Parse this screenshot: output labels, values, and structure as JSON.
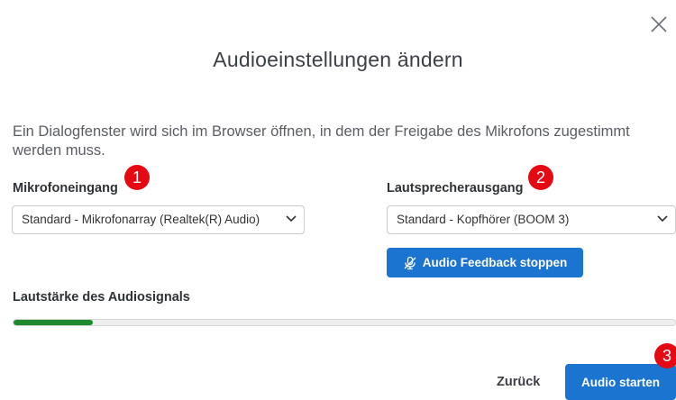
{
  "dialog": {
    "title": "Audioeinstellungen ändern",
    "description": "Ein Dialogfenster wird sich im Browser öffnen, in dem der Freigabe des Mikrofons zugestimmt werden muss."
  },
  "microphone": {
    "label": "Mikrofoneingang",
    "selected": "Standard - Mikrofonarray (Realtek(R) Audio)",
    "badge": "1"
  },
  "speaker": {
    "label": "Lautsprecherausgang",
    "selected": "Standard - Kopfhörer (BOOM 3)",
    "badge": "2",
    "feedback_button": "Audio Feedback stoppen"
  },
  "volume": {
    "label": "Lautstärke des Audiosignals",
    "level_fraction": 0.12
  },
  "footer": {
    "back_button": "Zurück",
    "start_button": "Audio starten",
    "badge": "3"
  },
  "colors": {
    "primary": "#1b74d0",
    "badge": "#e50914",
    "volume_fill": "#1d8a2f"
  },
  "icons": {
    "close": "close-icon",
    "chevron": "chevron-down-icon",
    "mic_muted": "microphone-muted-icon"
  }
}
